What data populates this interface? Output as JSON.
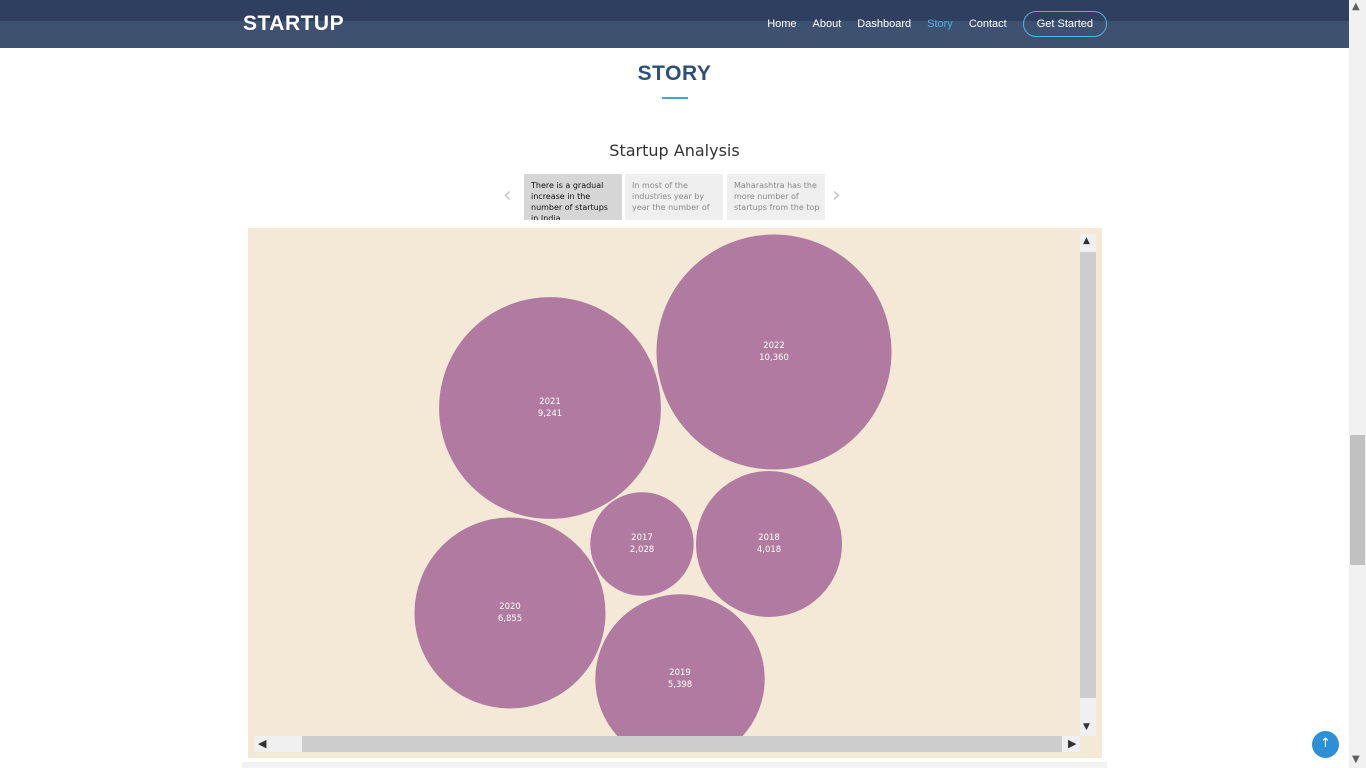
{
  "header": {
    "logo": "STARTUP",
    "nav": [
      "Home",
      "About",
      "Dashboard",
      "Story",
      "Contact"
    ],
    "active": "Story",
    "cta": "Get Started"
  },
  "section": {
    "title": "STORY",
    "story_title": "Startup Analysis"
  },
  "story_points": [
    "There is a gradual increase in the number of startups in India",
    "In most of the industries year by year the number of",
    "Maharashtra has the more number of startups from the top"
  ],
  "colors": {
    "header": "#3f5170",
    "accent": "#4fb2e6",
    "bubble": "#b07aa1",
    "viz_background": "#f4e8d7"
  },
  "chart_data": {
    "type": "bubble",
    "title": "",
    "bubbles": [
      {
        "year": "2017",
        "value": 2028,
        "label": "2,028"
      },
      {
        "year": "2018",
        "value": 4018,
        "label": "4,018"
      },
      {
        "year": "2019",
        "value": 5398,
        "label": "5,398"
      },
      {
        "year": "2020",
        "value": 6855,
        "label": "6,855"
      },
      {
        "year": "2021",
        "value": 9241,
        "label": "9,241"
      },
      {
        "year": "2022",
        "value": 10360,
        "label": "10,360"
      }
    ]
  },
  "icons": {
    "back_to_top": "arrow-up-icon",
    "story_prev": "chevron-left-icon",
    "story_next": "chevron-right-icon"
  }
}
